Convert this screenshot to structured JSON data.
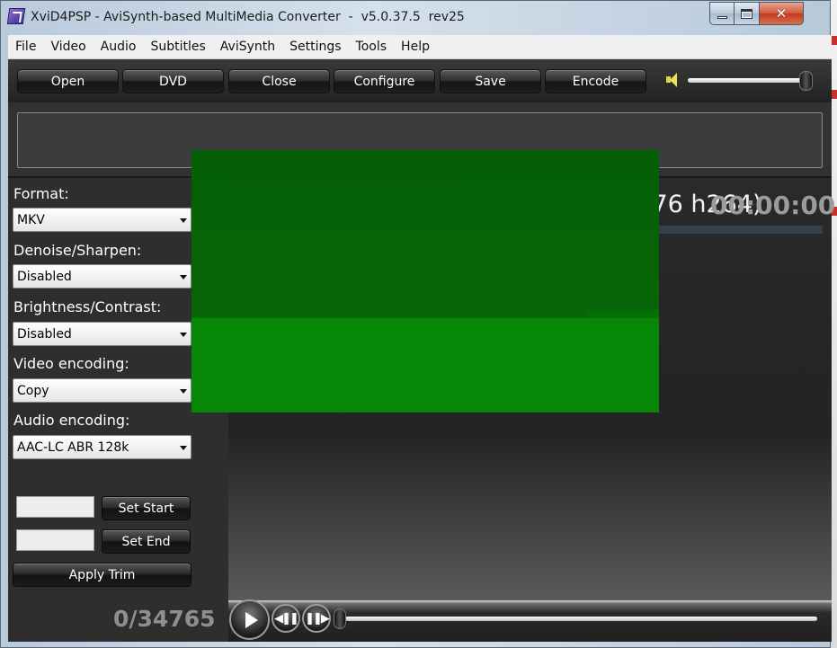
{
  "window": {
    "title": "XviD4PSP - AviSynth-based MultiMedia Converter  -  v5.0.37.5  rev25",
    "minimize_icon": "minimize-icon",
    "maximize_icon": "maximize-icon",
    "close_glyph": "✕"
  },
  "menu": [
    "File",
    "Video",
    "Audio",
    "Subtitles",
    "AviSynth",
    "Settings",
    "Tools",
    "Help"
  ],
  "toolbar": {
    "buttons": [
      "Open",
      "DVD",
      "Close",
      "Configure",
      "Save",
      "Encode"
    ],
    "volume_icon": "speaker-icon",
    "volume_level": 0.96
  },
  "settings": {
    "format": {
      "label": "Format:",
      "value": "MKV"
    },
    "denoise": {
      "label": "Denoise/Sharpen:",
      "value": "Disabled"
    },
    "brightness": {
      "label": "Brightness/Contrast:",
      "value": "Disabled"
    },
    "video_encoding": {
      "label": "Video encoding:",
      "value": "Copy"
    },
    "audio_encoding": {
      "label": "Audio encoding:",
      "value": "AAC-LC ABR 128k"
    }
  },
  "trim": {
    "start_value": "",
    "end_value": "",
    "set_start": "Set Start",
    "set_end": "Set End",
    "apply": "Apply Trim"
  },
  "preview": {
    "file_title": "[SS-Eclipse] Clannad - 01 (1024x576 h264)",
    "time": "00:00:00",
    "video_color": "#077607"
  },
  "playback": {
    "frame_counter": "0/34765",
    "play_icon": "play-icon",
    "step_back_icon": "frame-back-icon",
    "step_forward_icon": "frame-forward-icon",
    "seek_position": 0.0
  }
}
